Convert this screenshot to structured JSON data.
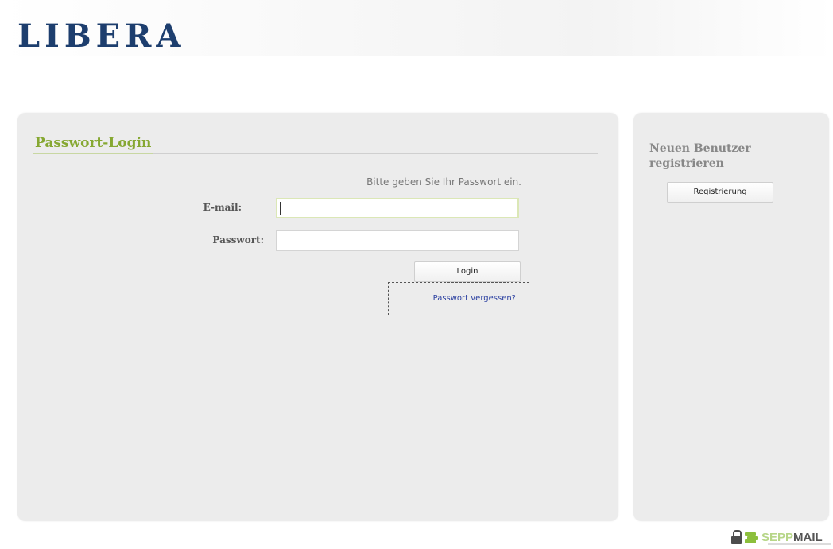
{
  "logo": {
    "text": "LIBERA",
    "color": "#1d3e6e"
  },
  "login_panel": {
    "title": "Passwort-Login",
    "instruction": "Bitte geben Sie Ihr Passwort ein.",
    "email_label": "E-mail:",
    "email_value": "",
    "password_label": "Passwort:",
    "password_value": "",
    "login_button": "Login",
    "forgot_link": "Passwort vergessen?"
  },
  "register_panel": {
    "title": "Neuen Benutzer registrieren",
    "register_button": "Registrierung"
  },
  "brand": {
    "light_part": "SEPP",
    "dark_part": "MAIL",
    "icon": "lock-icon"
  },
  "colors": {
    "accent_green": "#86a832",
    "panel_bg": "#ececec",
    "link_blue": "#2a3fa0"
  }
}
